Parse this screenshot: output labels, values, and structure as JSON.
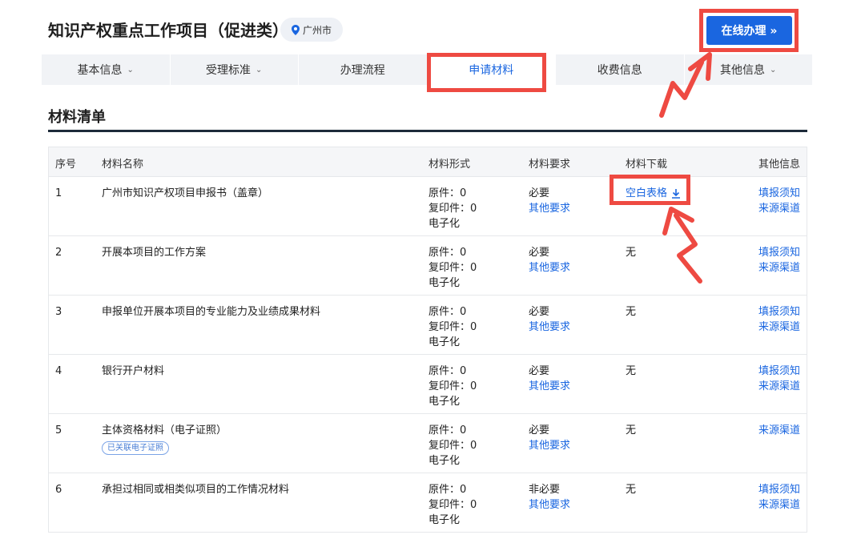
{
  "header": {
    "title": "知识产权重点工作项目（促进类）",
    "location": "广州市",
    "online_button": "在线办理 »"
  },
  "tabs": [
    {
      "label": "基本信息",
      "dropdown": true,
      "active": false
    },
    {
      "label": "受理标准",
      "dropdown": true,
      "active": false
    },
    {
      "label": "办理流程",
      "dropdown": false,
      "active": false
    },
    {
      "label": "申请材料",
      "dropdown": false,
      "active": true
    },
    {
      "label": "收费信息",
      "dropdown": false,
      "active": false
    },
    {
      "label": "其他信息",
      "dropdown": true,
      "active": false
    }
  ],
  "section_title": "材料清单",
  "table": {
    "headers": [
      "序号",
      "材料名称",
      "材料形式",
      "材料要求",
      "材料下载",
      "其他信息"
    ],
    "rows": [
      {
        "idx": "1",
        "name": "广州市知识产权项目申报书（盖章）",
        "tag": "",
        "form": [
          "原件：0",
          "复印件：0",
          "电子化"
        ],
        "req": "必要",
        "req_link": "其他要求",
        "download": "空白表格",
        "download_is_link": true,
        "other": [
          "填报须知",
          "来源渠道"
        ]
      },
      {
        "idx": "2",
        "name": "开展本项目的工作方案",
        "tag": "",
        "form": [
          "原件：0",
          "复印件：0",
          "电子化"
        ],
        "req": "必要",
        "req_link": "其他要求",
        "download": "无",
        "download_is_link": false,
        "other": [
          "填报须知",
          "来源渠道"
        ]
      },
      {
        "idx": "3",
        "name": "申报单位开展本项目的专业能力及业绩成果材料",
        "tag": "",
        "form": [
          "原件：0",
          "复印件：0",
          "电子化"
        ],
        "req": "必要",
        "req_link": "其他要求",
        "download": "无",
        "download_is_link": false,
        "other": [
          "填报须知",
          "来源渠道"
        ]
      },
      {
        "idx": "4",
        "name": "银行开户材料",
        "tag": "",
        "form": [
          "原件：0",
          "复印件：0",
          "电子化"
        ],
        "req": "必要",
        "req_link": "其他要求",
        "download": "无",
        "download_is_link": false,
        "other": [
          "填报须知",
          "来源渠道"
        ]
      },
      {
        "idx": "5",
        "name": "主体资格材料（电子证照）",
        "tag": "已关联电子证照",
        "form": [
          "原件：0",
          "复印件：0",
          "电子化"
        ],
        "req": "必要",
        "req_link": "其他要求",
        "download": "无",
        "download_is_link": false,
        "other": [
          "来源渠道"
        ]
      },
      {
        "idx": "6",
        "name": "承担过相同或相类似项目的工作情况材料",
        "tag": "",
        "form": [
          "原件：0",
          "复印件：0",
          "电子化"
        ],
        "req": "非必要",
        "req_link": "其他要求",
        "download": "无",
        "download_is_link": false,
        "other": [
          "填报须知",
          "来源渠道"
        ]
      }
    ]
  },
  "colors": {
    "accent": "#1a66e0",
    "highlight": "#ee4a42"
  },
  "icons": {
    "location": "location-pin-icon",
    "download": "download-icon",
    "dropdown": "chevron-down-icon",
    "annotation": "arrow-annotation-icon"
  }
}
